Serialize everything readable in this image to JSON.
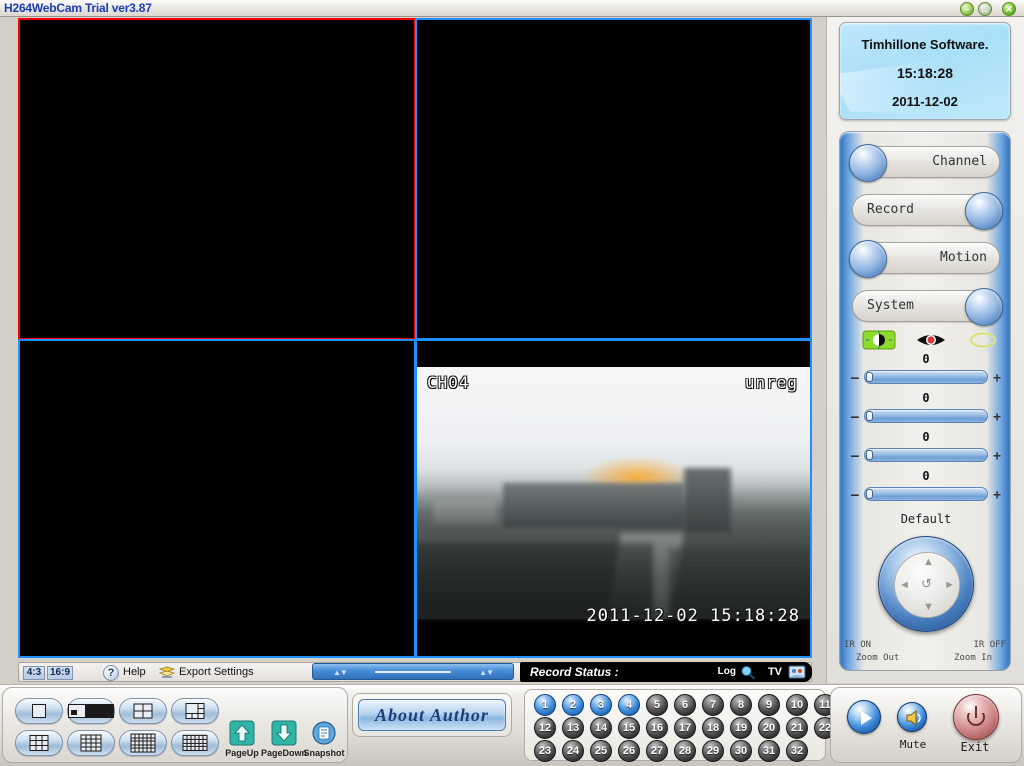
{
  "window": {
    "title": "H264WebCam Trial ver3.87",
    "minimize": "–",
    "maximize": "□",
    "close": "✕"
  },
  "brand": {
    "name": "Timhillone Software.",
    "time": "15:18:28",
    "date": "2011-12-02"
  },
  "video": {
    "panes": [
      {
        "id": "quad1",
        "selected": true,
        "signal": false
      },
      {
        "id": "quad2",
        "selected": false,
        "signal": false
      },
      {
        "id": "quad3",
        "selected": false,
        "signal": false
      },
      {
        "id": "quad4",
        "selected": false,
        "signal": true
      }
    ],
    "active_pane": {
      "channel_label": "CH04",
      "registration": "unreg",
      "timestamp": "2011-12-02  15:18:28"
    }
  },
  "statusbar": {
    "ratio_4_3": "4:3",
    "ratio_16_9": "16:9",
    "help_icon": "?",
    "help_label": "Help",
    "export_icon": "export-settings-icon",
    "export_label": "Export Settings"
  },
  "record_bar": {
    "label": "Record Status :",
    "log_label": "Log",
    "log_icon": "magnifier-icon",
    "tv_label": "TV",
    "tv_icon": "tv-icon"
  },
  "control_panel": {
    "buttons": [
      {
        "label": "Channel",
        "knob": "left"
      },
      {
        "label": "Record",
        "knob": "right"
      },
      {
        "label": "Motion",
        "knob": "left"
      },
      {
        "label": "System",
        "knob": "right"
      }
    ],
    "image_icons": [
      {
        "name": "brightness-icon"
      },
      {
        "name": "eye-icon"
      },
      {
        "name": "hue-ring-icon"
      }
    ],
    "sliders": [
      {
        "value": "0",
        "minus": "–",
        "plus": "+"
      },
      {
        "value": "0",
        "minus": "–",
        "plus": "+"
      },
      {
        "value": "0",
        "minus": "–",
        "plus": "+"
      },
      {
        "value": "0",
        "minus": "–",
        "plus": "+"
      }
    ],
    "default_label": "Default",
    "ptz": {
      "up": "▲",
      "down": "▼",
      "left": "◄",
      "right": "►",
      "center": "↺",
      "ir_on": "IR ON",
      "ir_off": "IR OFF",
      "zoom_out": "Zoom Out",
      "zoom_in": "Zoom In"
    }
  },
  "dock": {
    "layouts": [
      {
        "name": "layout-1",
        "cols": 1,
        "rows": 1,
        "style": "full"
      },
      {
        "name": "layout-pip",
        "cols": 1,
        "rows": 1,
        "style": "pip"
      },
      {
        "name": "layout-4",
        "cols": 2,
        "rows": 2,
        "style": "grid"
      },
      {
        "name": "layout-6",
        "cols": 3,
        "rows": 3,
        "style": "six"
      },
      {
        "name": "layout-8",
        "cols": 3,
        "rows": 3,
        "style": "grid"
      },
      {
        "name": "layout-9",
        "cols": 4,
        "rows": 4,
        "style": "grid"
      },
      {
        "name": "layout-16",
        "cols": 6,
        "rows": 5,
        "style": "grid"
      },
      {
        "name": "layout-13",
        "cols": 6,
        "rows": 4,
        "style": "grid"
      }
    ],
    "pageup_label": "PageUp",
    "pagedown_label": "PageDown",
    "snapshot_label": "Snapshot",
    "about_label": "About  Author",
    "channels": [
      {
        "n": "1",
        "on": true
      },
      {
        "n": "2",
        "on": true
      },
      {
        "n": "3",
        "on": true
      },
      {
        "n": "4",
        "on": true
      },
      {
        "n": "5",
        "on": false
      },
      {
        "n": "6",
        "on": false
      },
      {
        "n": "7",
        "on": false
      },
      {
        "n": "8",
        "on": false
      },
      {
        "n": "9",
        "on": false
      },
      {
        "n": "10",
        "on": false
      },
      {
        "n": "11",
        "on": false
      },
      {
        "n": "12",
        "on": false
      },
      {
        "n": "13",
        "on": false
      },
      {
        "n": "14",
        "on": false
      },
      {
        "n": "15",
        "on": false
      },
      {
        "n": "16",
        "on": false
      },
      {
        "n": "17",
        "on": false
      },
      {
        "n": "18",
        "on": false
      },
      {
        "n": "19",
        "on": false
      },
      {
        "n": "20",
        "on": false
      },
      {
        "n": "21",
        "on": false
      },
      {
        "n": "22",
        "on": false
      },
      {
        "n": "23",
        "on": false
      },
      {
        "n": "24",
        "on": false
      },
      {
        "n": "25",
        "on": false
      },
      {
        "n": "26",
        "on": false
      },
      {
        "n": "27",
        "on": false
      },
      {
        "n": "28",
        "on": false
      },
      {
        "n": "29",
        "on": false
      },
      {
        "n": "30",
        "on": false
      },
      {
        "n": "31",
        "on": false
      },
      {
        "n": "32",
        "on": false
      }
    ],
    "play_icon": "play-icon",
    "mute_label": "Mute",
    "mute_icon": "speaker-icon",
    "exit_label": "Exit",
    "exit_icon": "power-icon"
  },
  "colors": {
    "selection_border": "#ff0000",
    "pane_border": "#1e90ff",
    "title_text": "#1a3fb4",
    "channel_active": "#3d8ada",
    "exit_red": "#b86a6a"
  }
}
